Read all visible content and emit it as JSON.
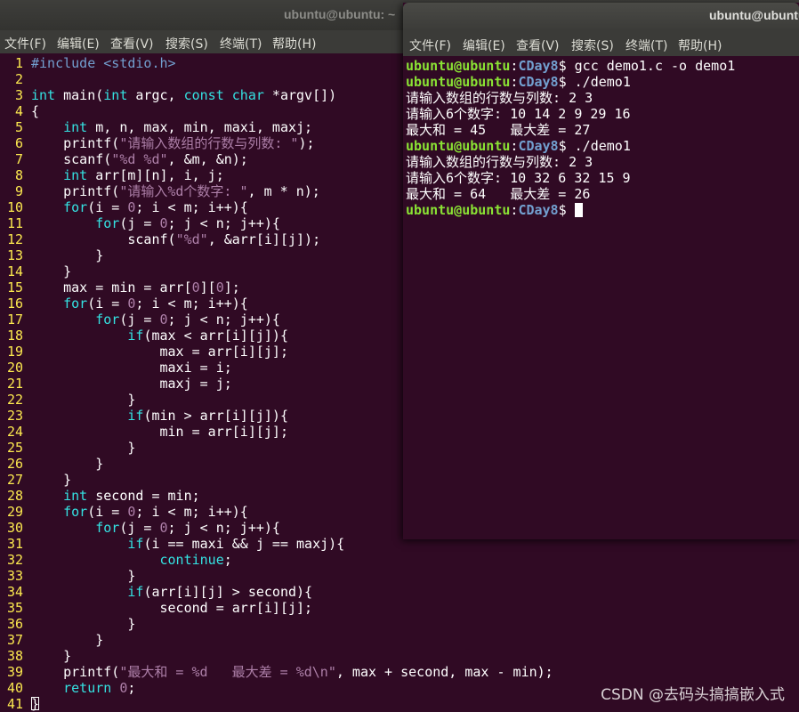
{
  "editor_window": {
    "title": "ubuntu@ubuntu: ~",
    "menu": [
      "文件(F)",
      "编辑(E)",
      "查看(V)",
      "搜索(S)",
      "终端(T)",
      "帮助(H)"
    ]
  },
  "terminal_window": {
    "title": "ubuntu@ubuntu",
    "menu": [
      "文件(F)",
      "编辑(E)",
      "查看(V)",
      "搜索(S)",
      "终端(T)",
      "帮助(H)"
    ],
    "prompt_user": "ubuntu@ubuntu",
    "prompt_path": "CDay8",
    "lines": [
      {
        "type": "prompt",
        "cmd": "gcc demo1.c -o demo1"
      },
      {
        "type": "prompt",
        "cmd": "./demo1"
      },
      {
        "type": "out",
        "text": "请输入数组的行数与列数: 2 3"
      },
      {
        "type": "out",
        "text": "请输入6个数字: 10 14 2 9 29 16"
      },
      {
        "type": "out",
        "text": "最大和 = 45   最大差 = 27"
      },
      {
        "type": "prompt",
        "cmd": "./demo1"
      },
      {
        "type": "out",
        "text": "请输入数组的行数与列数: 2 3"
      },
      {
        "type": "out",
        "text": "请输入6个数字: 10 32 6 32 15 9"
      },
      {
        "type": "out",
        "text": "最大和 = 64   最大差 = 26"
      },
      {
        "type": "prompt",
        "cmd": "",
        "cursor": true
      }
    ]
  },
  "code": [
    [
      [
        "pp",
        "#include <stdio.h>"
      ]
    ],
    [],
    [
      [
        "k",
        "int"
      ],
      [
        "o",
        " main("
      ],
      [
        "k",
        "int"
      ],
      [
        "o",
        " argc, "
      ],
      [
        "k",
        "const"
      ],
      [
        "o",
        " "
      ],
      [
        "k",
        "char"
      ],
      [
        "o",
        " *argv[])"
      ]
    ],
    [
      [
        "o",
        "{"
      ]
    ],
    [
      [
        "o",
        "    "
      ],
      [
        "k",
        "int"
      ],
      [
        "o",
        " m, n, max, min, maxi, maxj;"
      ]
    ],
    [
      [
        "o",
        "    printf("
      ],
      [
        "s",
        "\"请输入数组的行数与列数: \""
      ],
      [
        "o",
        ");"
      ]
    ],
    [
      [
        "o",
        "    scanf("
      ],
      [
        "s",
        "\"%d %d\""
      ],
      [
        "o",
        ", &m, &n);"
      ]
    ],
    [
      [
        "o",
        "    "
      ],
      [
        "k",
        "int"
      ],
      [
        "o",
        " arr[m][n], i, j;"
      ]
    ],
    [
      [
        "o",
        "    printf("
      ],
      [
        "s",
        "\"请输入%d个数字: \""
      ],
      [
        "o",
        ", m * n);"
      ]
    ],
    [
      [
        "o",
        "    "
      ],
      [
        "k",
        "for"
      ],
      [
        "o",
        "(i = "
      ],
      [
        "n",
        "0"
      ],
      [
        "o",
        "; i < m; i++){"
      ]
    ],
    [
      [
        "o",
        "        "
      ],
      [
        "k",
        "for"
      ],
      [
        "o",
        "(j = "
      ],
      [
        "n",
        "0"
      ],
      [
        "o",
        "; j < n; j++){"
      ]
    ],
    [
      [
        "o",
        "            scanf("
      ],
      [
        "s",
        "\"%d\""
      ],
      [
        "o",
        ", &arr[i][j]);"
      ]
    ],
    [
      [
        "o",
        "        }"
      ]
    ],
    [
      [
        "o",
        "    }"
      ]
    ],
    [
      [
        "o",
        "    max = min = arr["
      ],
      [
        "n",
        "0"
      ],
      [
        "o",
        "]["
      ],
      [
        "n",
        "0"
      ],
      [
        "o",
        "];"
      ]
    ],
    [
      [
        "o",
        "    "
      ],
      [
        "k",
        "for"
      ],
      [
        "o",
        "(i = "
      ],
      [
        "n",
        "0"
      ],
      [
        "o",
        "; i < m; i++){"
      ]
    ],
    [
      [
        "o",
        "        "
      ],
      [
        "k",
        "for"
      ],
      [
        "o",
        "(j = "
      ],
      [
        "n",
        "0"
      ],
      [
        "o",
        "; j < n; j++){"
      ]
    ],
    [
      [
        "o",
        "            "
      ],
      [
        "k",
        "if"
      ],
      [
        "o",
        "(max < arr[i][j]){"
      ]
    ],
    [
      [
        "o",
        "                max = arr[i][j];"
      ]
    ],
    [
      [
        "o",
        "                maxi = i;"
      ]
    ],
    [
      [
        "o",
        "                maxj = j;"
      ]
    ],
    [
      [
        "o",
        "            }"
      ]
    ],
    [
      [
        "o",
        "            "
      ],
      [
        "k",
        "if"
      ],
      [
        "o",
        "(min > arr[i][j]){"
      ]
    ],
    [
      [
        "o",
        "                min = arr[i][j];"
      ]
    ],
    [
      [
        "o",
        "            }"
      ]
    ],
    [
      [
        "o",
        "        }"
      ]
    ],
    [
      [
        "o",
        "    }"
      ]
    ],
    [
      [
        "o",
        "    "
      ],
      [
        "k",
        "int"
      ],
      [
        "o",
        " second = min;"
      ]
    ],
    [
      [
        "o",
        "    "
      ],
      [
        "k",
        "for"
      ],
      [
        "o",
        "(i = "
      ],
      [
        "n",
        "0"
      ],
      [
        "o",
        "; i < m; i++){"
      ]
    ],
    [
      [
        "o",
        "        "
      ],
      [
        "k",
        "for"
      ],
      [
        "o",
        "(j = "
      ],
      [
        "n",
        "0"
      ],
      [
        "o",
        "; j < n; j++){"
      ]
    ],
    [
      [
        "o",
        "            "
      ],
      [
        "k",
        "if"
      ],
      [
        "o",
        "(i == maxi && j == maxj){"
      ]
    ],
    [
      [
        "o",
        "                "
      ],
      [
        "k",
        "continue"
      ],
      [
        "o",
        ";"
      ]
    ],
    [
      [
        "o",
        "            }"
      ]
    ],
    [
      [
        "o",
        "            "
      ],
      [
        "k",
        "if"
      ],
      [
        "o",
        "(arr[i][j] > second){"
      ]
    ],
    [
      [
        "o",
        "                second = arr[i][j];"
      ]
    ],
    [
      [
        "o",
        "            }"
      ]
    ],
    [
      [
        "o",
        "        }"
      ]
    ],
    [
      [
        "o",
        "    }"
      ]
    ],
    [
      [
        "o",
        "    printf("
      ],
      [
        "s",
        "\"最大和 = %d   最大差 = %d\\n\""
      ],
      [
        "o",
        ", max + second, max - min);"
      ]
    ],
    [
      [
        "o",
        "    "
      ],
      [
        "k",
        "return"
      ],
      [
        "o",
        " "
      ],
      [
        "n",
        "0"
      ],
      [
        "o",
        ";"
      ]
    ],
    [
      [
        "o",
        "}"
      ]
    ]
  ],
  "watermark": "CSDN @去码头搞搞嵌入式"
}
